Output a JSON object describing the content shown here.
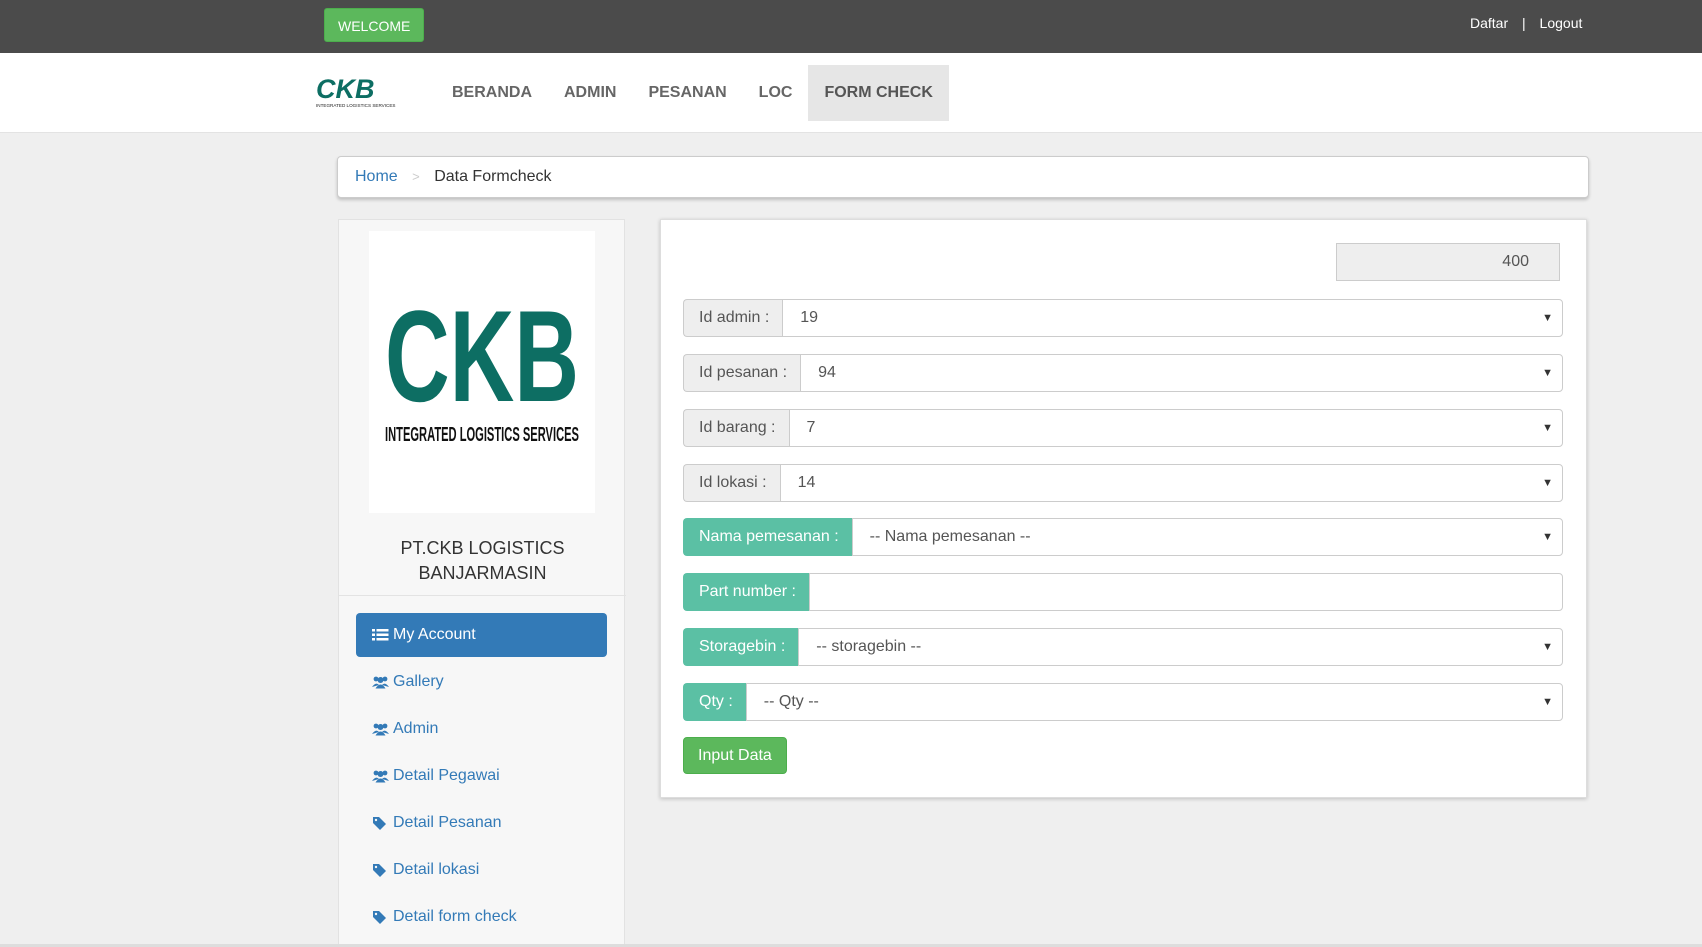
{
  "topbar": {
    "welcome_label": "WELCOME",
    "register_label": "Daftar",
    "separator": "|",
    "logout_label": "Logout"
  },
  "nav": {
    "logo_text": "CKB",
    "logo_sub": "INTEGRATED LOGISTICS SERVICES",
    "items": [
      {
        "label": "BERANDA"
      },
      {
        "label": "ADMIN"
      },
      {
        "label": "PESANAN"
      },
      {
        "label": "LOC"
      },
      {
        "label": "FORM CHECK"
      }
    ],
    "active_index": 4
  },
  "breadcrumb": {
    "home": "Home",
    "separator": ">",
    "current": "Data Formcheck"
  },
  "sidebar": {
    "logo_text": "CKB",
    "logo_sub": "INTEGRATED LOGISTICS SERVICES",
    "company_line1": "PT.CKB LOGISTICS",
    "company_line2": "BANJARMASIN",
    "menu": [
      {
        "label": "My Account",
        "icon": "list-icon"
      },
      {
        "label": "Gallery",
        "icon": "users-icon"
      },
      {
        "label": "Admin",
        "icon": "users-icon"
      },
      {
        "label": "Detail Pegawai",
        "icon": "users-icon"
      },
      {
        "label": "Detail Pesanan",
        "icon": "tag-icon"
      },
      {
        "label": "Detail lokasi",
        "icon": "tag-icon"
      },
      {
        "label": "Detail form check",
        "icon": "tag-icon"
      }
    ]
  },
  "form": {
    "count_value": "400",
    "id_admin": {
      "label": "Id admin :",
      "value": "19"
    },
    "id_pesanan": {
      "label": "Id pesanan :",
      "value": "94"
    },
    "id_barang": {
      "label": "Id barang :",
      "value": "7"
    },
    "id_lokasi": {
      "label": "Id lokasi :",
      "value": "14"
    },
    "nama_pemesanan": {
      "label": "Nama pemesanan :",
      "value": "-- Nama pemesanan --"
    },
    "part_number": {
      "label": "Part number :",
      "value": ""
    },
    "storagebin": {
      "label": "Storagebin :",
      "value": "-- storagebin --"
    },
    "qty": {
      "label": "Qty :",
      "value": "-- Qty --"
    },
    "submit_label": "Input Data"
  },
  "colors": {
    "topbar": "#4b4b4b",
    "success": "#5cb85c",
    "teal_addon": "#5bc0a4",
    "primary": "#337ab7",
    "logo_green": "#0d6e63"
  }
}
